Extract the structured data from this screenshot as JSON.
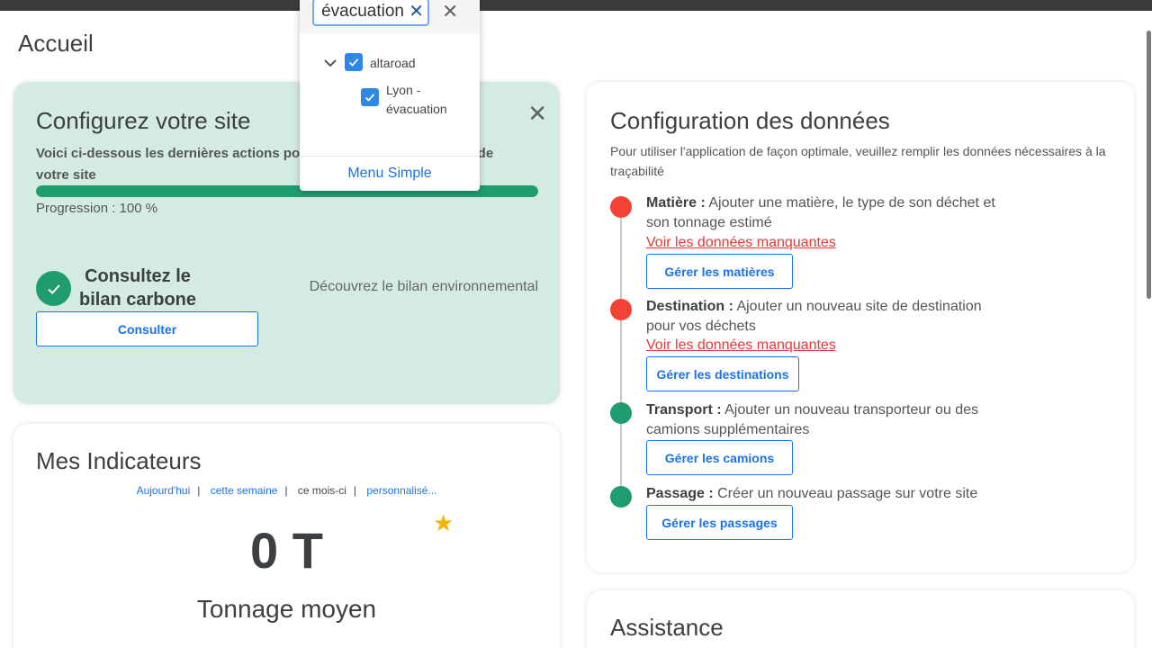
{
  "page": {
    "title": "Accueil"
  },
  "configure": {
    "title": "Configurez votre site",
    "description": "Voici ci-dessous les dernières actions pour finaliser la configuration de votre site",
    "progress_value": 100,
    "progress_label": "Progression : 100 %",
    "bilan_title": "Consultez le bilan carbone",
    "bilan_desc": "Découvrez le bilan environnemental",
    "consult_button": "Consulter",
    "close_icon": "close-icon"
  },
  "indicateurs": {
    "title": "Mes Indicateurs",
    "filters": [
      {
        "label": "Aujourd'hui"
      },
      {
        "label": "cette semaine"
      },
      {
        "label": "ce mois-ci"
      },
      {
        "label": "personnalisé..."
      }
    ],
    "value": "0 T",
    "label": "Tonnage moyen"
  },
  "data_config": {
    "title": "Configuration des données",
    "description": "Pour utiliser l'application de façon optimale, veuillez remplir les données nécessaires à la traçabilité",
    "steps": [
      {
        "name": "Matière :",
        "text": " Ajouter une matière, le type de son déchet et son tonnage estimé",
        "link": "Voir les données manquantes",
        "button": "Gérer les matières",
        "status_color": "#f44336"
      },
      {
        "name": "Destination :",
        "text": " Ajouter un nouveau site de destination pour vos déchets",
        "link": "Voir les données manquantes",
        "button": "Gérer les destinations",
        "status_color": "#f44336"
      },
      {
        "name": "Transport :",
        "text": " Ajouter un nouveau transporteur ou des camions supplémentaires",
        "button": "Gérer les camions",
        "status_color": "#1f9d6e"
      },
      {
        "name": "Passage :",
        "text": " Créer un nouveau passage sur votre site",
        "button": "Gérer les passages",
        "status_color": "#1f9d6e"
      }
    ]
  },
  "assistance": {
    "title": "Assistance"
  },
  "site_picker": {
    "search_value": "évacuation",
    "tree": [
      {
        "label": "altaroad",
        "checked": true
      },
      {
        "label": "Lyon - évacuation",
        "checked": true
      }
    ],
    "footer": "Menu Simple"
  },
  "colors": {
    "accent": "#1a73e8",
    "success": "#1f9d6e",
    "danger": "#f44336",
    "configure_bg": "#d4ebe2"
  }
}
